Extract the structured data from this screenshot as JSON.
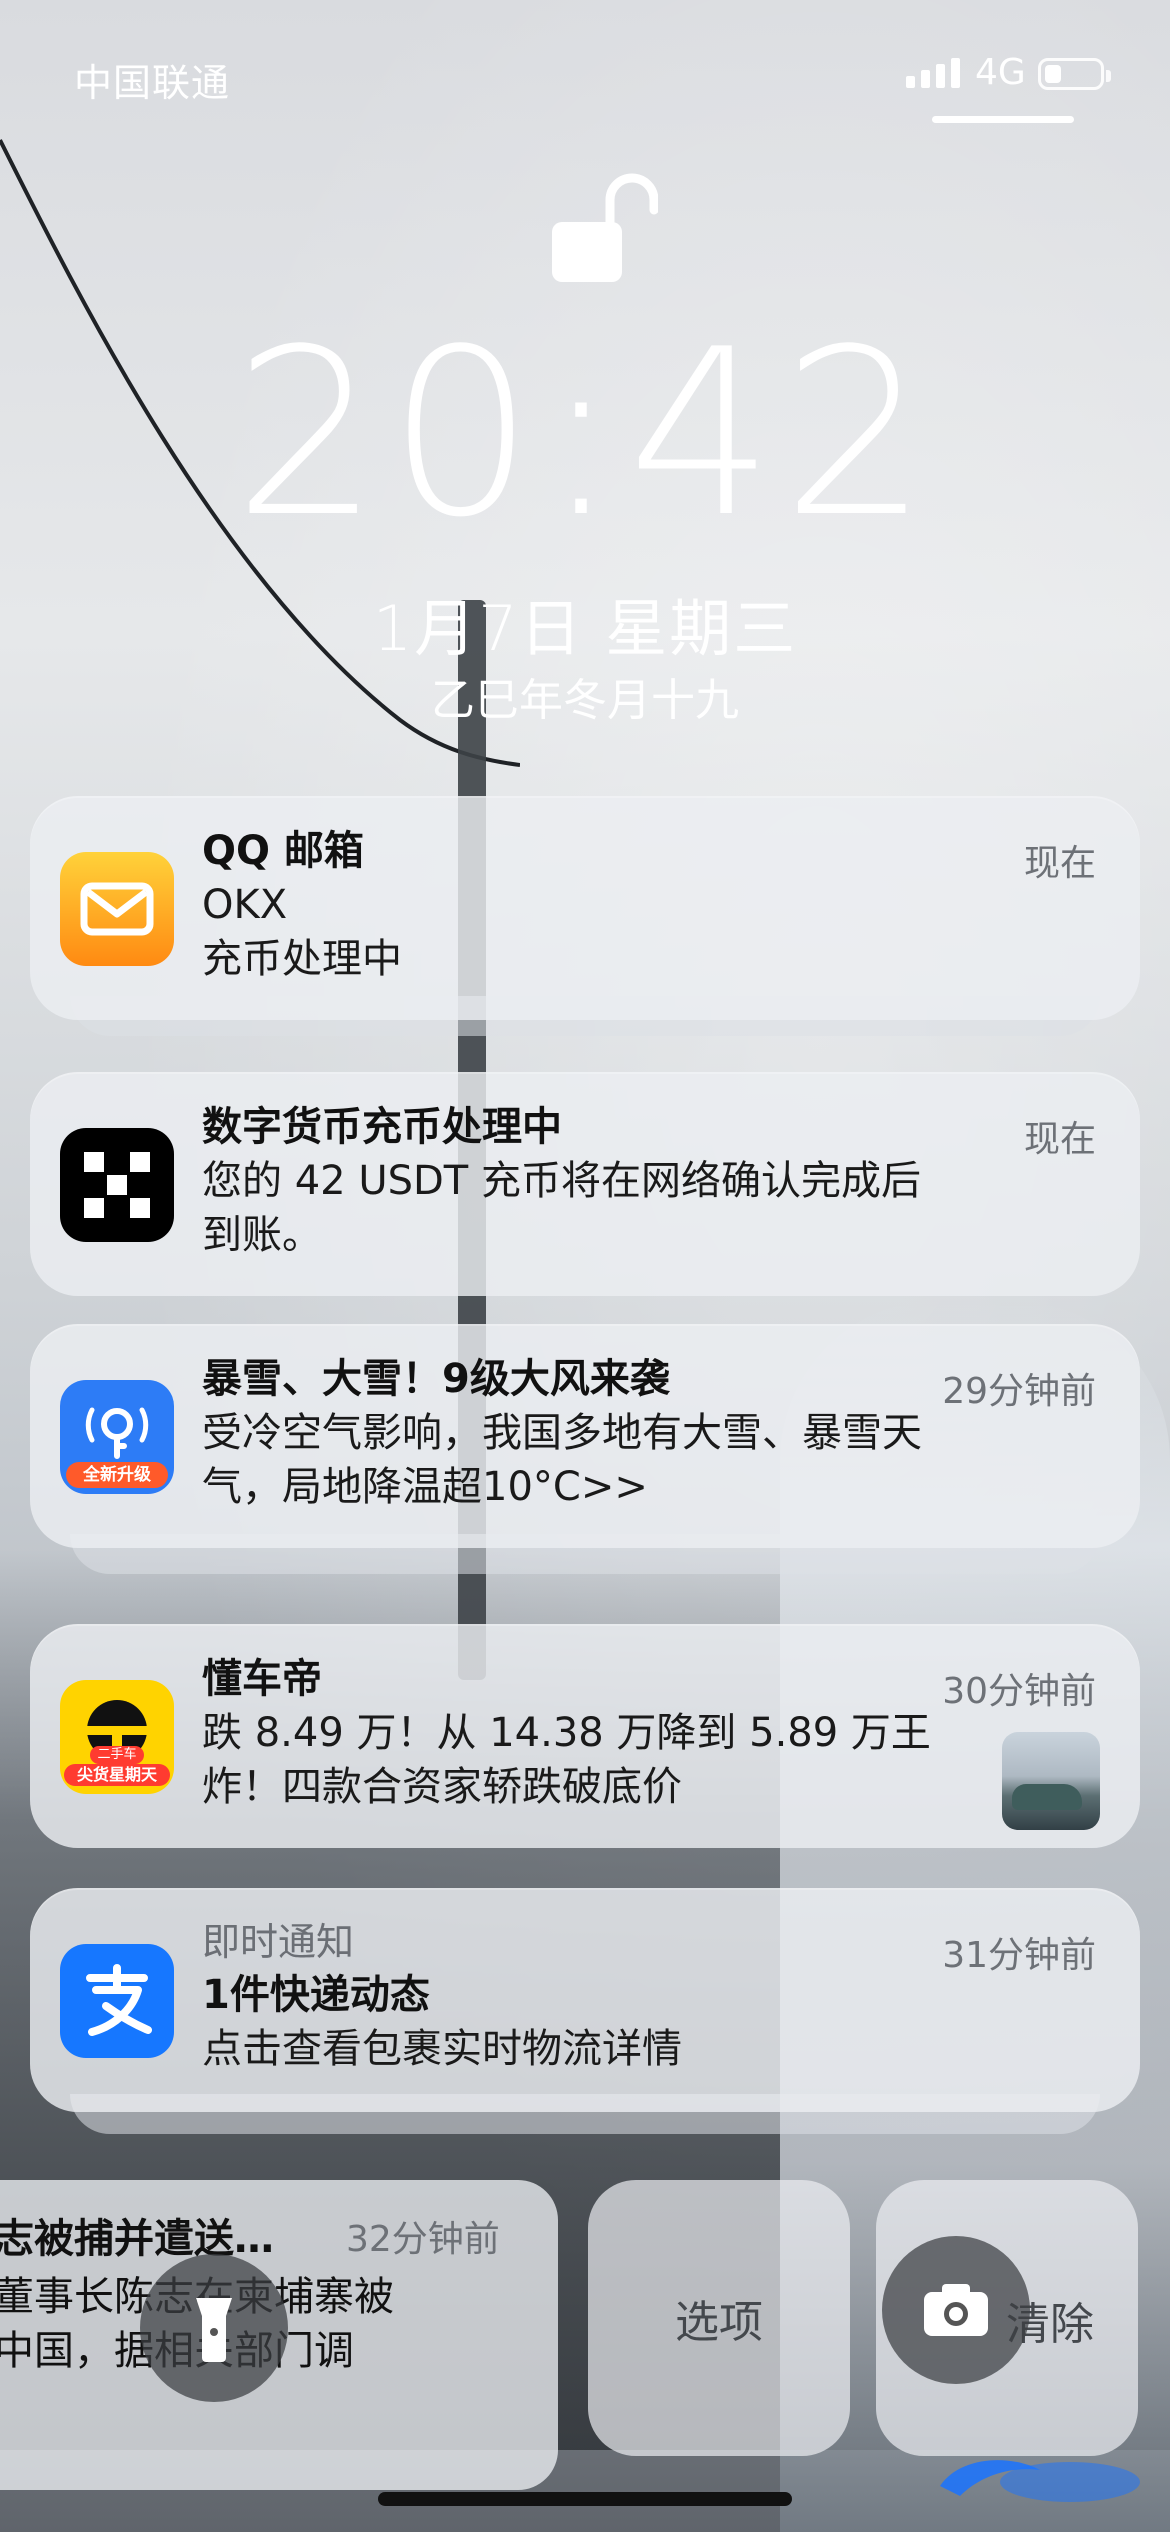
{
  "status_bar": {
    "carrier": "中国联通",
    "network": "4G",
    "battery_level": 0.3
  },
  "lock_screen": {
    "time": "20:42",
    "date": "1月7日 星期三",
    "lunar_date": "乙巳年冬月十九"
  },
  "notifications": [
    {
      "app": "QQ邮箱",
      "icon": "mail-icon",
      "title": "QQ 邮箱",
      "lines": [
        "OKX",
        "充币处理中"
      ],
      "time": "现在"
    },
    {
      "app": "OKX",
      "icon": "okx-icon",
      "title": "数字货币充币处理中",
      "lines": [
        "您的 42 USDT 充币将在网络确认完成后",
        "到账。"
      ],
      "time": "现在"
    },
    {
      "app": "WiFi万能钥匙",
      "icon": "wifi-key-icon",
      "icon_badge": "全新升级",
      "title": "暴雪、大雪！9级大风来袭",
      "lines": [
        "受冷空气影响，我国多地有大雪、暴雪天",
        "气，局地降温超10°C>>"
      ],
      "time": "29分钟前"
    },
    {
      "app": "懂车帝",
      "icon": "dongchedi-icon",
      "icon_badge_top": "二手车",
      "icon_badge": "尖货星期天",
      "title": "懂车帝",
      "lines": [
        "跌 8.49 万！从 14.38 万降到 5.89 万王",
        "炸！四款合资家轿跌破底价"
      ],
      "time": "30分钟前"
    },
    {
      "app": "支付宝",
      "icon": "alipay-icon",
      "subtitle": "即时通知",
      "title": "1件快递动态",
      "lines": [
        "点击查看包裹实时物流详情"
      ],
      "time": "31分钟前"
    }
  ],
  "partial_notification": {
    "title": "志被捕并遣送…",
    "time": "32分钟前",
    "lines": [
      "董事长陈志在柬埔寨被",
      "中国，据相关部门调"
    ]
  },
  "actions": {
    "options_label": "选项",
    "clear_label": "清除"
  },
  "colors": {
    "qq_mail_gradient": [
      "#ffd23a",
      "#ff8a12"
    ],
    "okx_bg": "#000000",
    "wifi_key_bg": "#2d7cf6",
    "dongchedi_bg": "#ffd300",
    "alipay_bg": "#1677ff"
  }
}
